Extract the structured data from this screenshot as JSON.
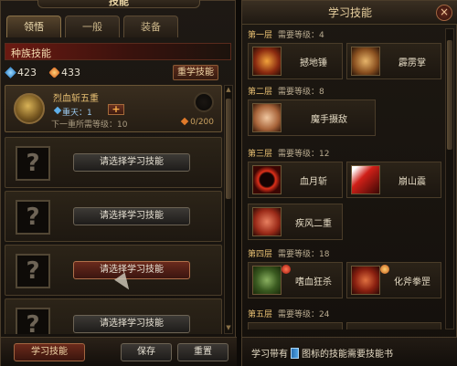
{
  "left": {
    "title": "技能",
    "tabs": [
      {
        "label": "领悟"
      },
      {
        "label": "一般"
      },
      {
        "label": "装备"
      }
    ],
    "race_skills_label": "种族技能",
    "stats": {
      "blue_value": "423",
      "orange_value": "433"
    },
    "relearn_label": "重学技能",
    "first_skill": {
      "name": "烈血斩五重",
      "level_text": "重天：1",
      "plus": "+",
      "next_req": "下一重所需等级：10",
      "points": "0/200"
    },
    "choose_label": "请选择学习技能",
    "buttons": {
      "learn": "学习技能",
      "save": "保存",
      "reset": "重置"
    }
  },
  "right": {
    "title": "学习技能",
    "close": "×",
    "tiers": [
      {
        "tier": "第一层",
        "req": "需要等级：4",
        "skills": [
          {
            "name": "撼地锤",
            "icon": "hammer-skill-icon"
          },
          {
            "name": "霹雳掌",
            "icon": "thunder-palm-icon"
          }
        ]
      },
      {
        "tier": "第二层",
        "req": "需要等级：8",
        "skills": [
          {
            "name": "魔手摄敌",
            "icon": "demon-hand-icon"
          }
        ]
      },
      {
        "tier": "第三层",
        "req": "需要等级：12",
        "skills": [
          {
            "name": "血月斩",
            "icon": "blood-moon-icon"
          },
          {
            "name": "崩山震",
            "icon": "mountain-quake-icon"
          },
          {
            "name": "疾风二重",
            "icon": "gale-strike-icon"
          }
        ]
      },
      {
        "tier": "第四层",
        "req": "需要等级：18",
        "skills": [
          {
            "name": "嗜血狂杀",
            "icon": "bloodlust-icon"
          },
          {
            "name": "化斧拳罡",
            "icon": "axe-fist-icon"
          }
        ]
      },
      {
        "tier": "第五层",
        "req": "需要等级：24",
        "skills": []
      }
    ],
    "footer": {
      "prefix": "学习带有",
      "suffix": "图标的技能需要技能书"
    }
  }
}
